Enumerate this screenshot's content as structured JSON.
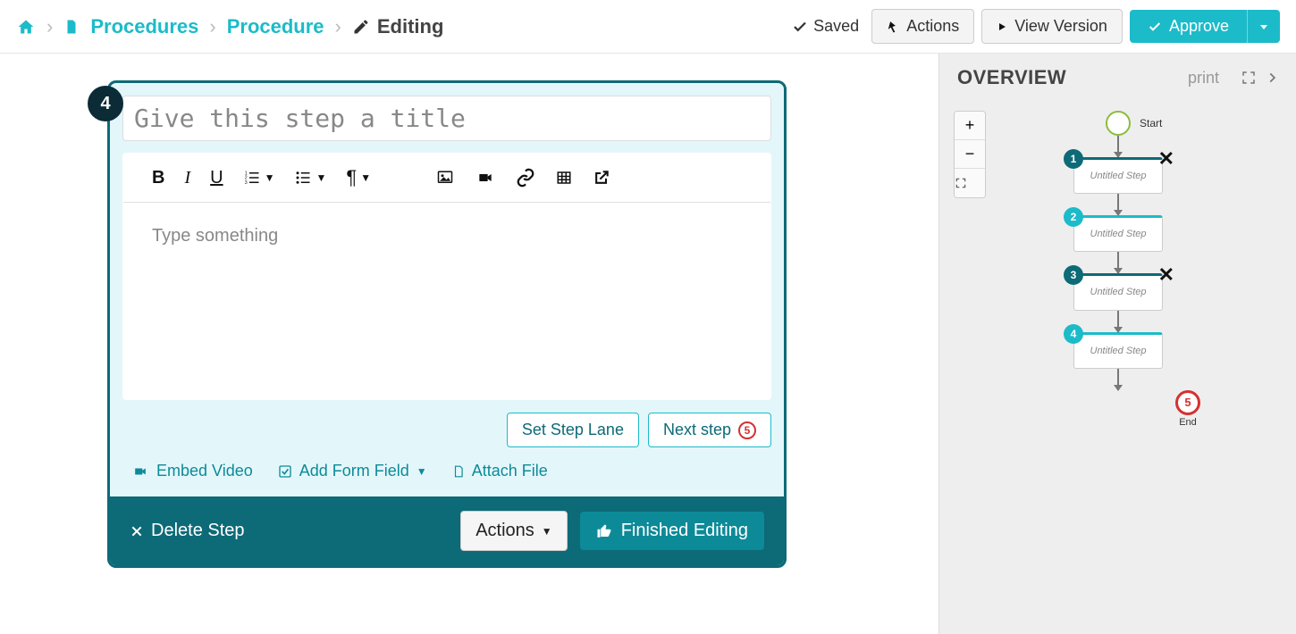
{
  "breadcrumb": {
    "procedures": "Procedures",
    "procedure": "Procedure",
    "editing": "Editing"
  },
  "topbar": {
    "saved": "Saved",
    "actions": "Actions",
    "view_version": "View Version",
    "approve": "Approve"
  },
  "editor": {
    "step_number": "4",
    "title_placeholder": "Give this step a title",
    "body_placeholder": "Type something",
    "set_lane": "Set Step Lane",
    "next_step": "Next step",
    "next_badge": "5",
    "embed_video": "Embed Video",
    "add_form_field": "Add Form Field",
    "attach_file": "Attach File",
    "delete_step": "Delete Step",
    "footer_actions": "Actions",
    "finished": "Finished Editing"
  },
  "overview": {
    "title": "OVERVIEW",
    "print": "print",
    "start": "Start",
    "end": "End",
    "end_badge": "5",
    "steps": [
      {
        "num": "1",
        "label": "Untitled Step",
        "selected": true,
        "has_x": true
      },
      {
        "num": "2",
        "label": "Untitled Step",
        "selected": false,
        "has_x": false
      },
      {
        "num": "3",
        "label": "Untitled Step",
        "selected": true,
        "has_x": true
      },
      {
        "num": "4",
        "label": "Untitled Step",
        "selected": false,
        "has_x": false
      }
    ]
  }
}
